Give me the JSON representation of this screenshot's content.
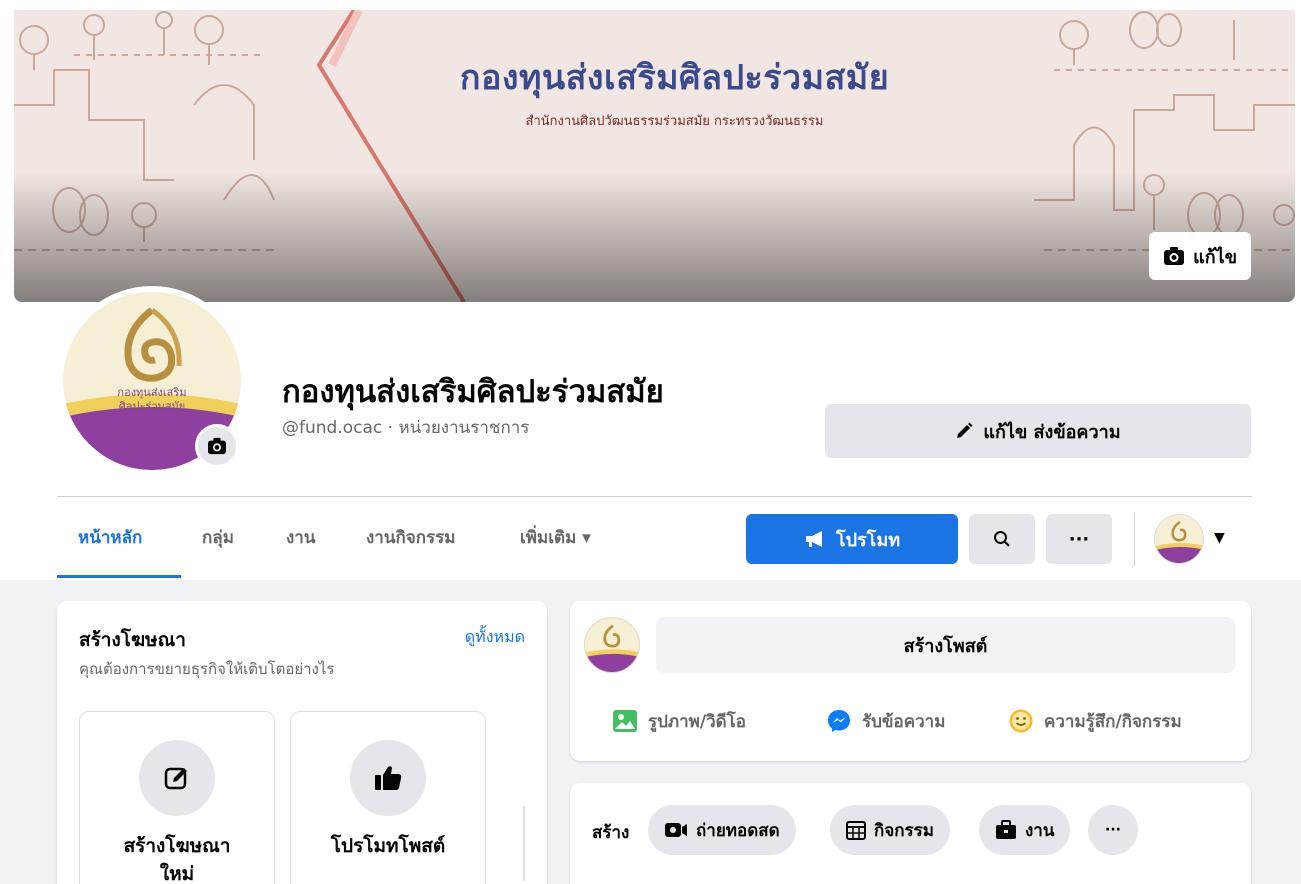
{
  "cover": {
    "title": "กองทุนส่งเสริมศิลปะร่วมสมัย",
    "subtitle": "สำนักงานศิลปวัฒนธรรมร่วมสมัย กระทรวงวัฒนธรรม",
    "edit_label": "แก้ไข"
  },
  "profile": {
    "name": "กองทุนส่งเสริมศิลปะร่วมสมัย",
    "handle": "@fund.ocac · หน่วยงานราชการ",
    "edit_send_label": "แก้ไข ส่งข้อความ"
  },
  "nav": {
    "tabs": [
      {
        "label": "หน้าหลัก",
        "active": true
      },
      {
        "label": "กลุ่ม"
      },
      {
        "label": "งาน"
      },
      {
        "label": "งานกิจกรรม"
      },
      {
        "label": "เพิ่มเติม ▾"
      }
    ],
    "promote_label": "โปรโมท",
    "more_label": "···"
  },
  "ads": {
    "title": "สร้างโฆษณา",
    "see_all": "ดูทั้งหมด",
    "subtitle": "คุณต้องการขยายธุรกิจให้เติบโตอย่างไร",
    "options": [
      {
        "label_line1": "สร้างโฆษณา",
        "label_line2": "ใหม่",
        "icon": "edit-icon"
      },
      {
        "label_line1": "โปรโมทโพสต์",
        "label_line2": "",
        "icon": "thumbs-up-icon"
      }
    ]
  },
  "composer": {
    "create_post_label": "สร้างโพสต์",
    "actions": [
      {
        "label": "รูปภาพ/วิดีโอ",
        "icon": "photo-icon",
        "color": "#45bd62"
      },
      {
        "label": "รับข้อความ",
        "icon": "messenger-icon",
        "color": "#0a7cff"
      },
      {
        "label": "ความรู้สึก/กิจกรรม",
        "icon": "smile-icon",
        "color": "#f7b928"
      }
    ]
  },
  "create_bar": {
    "label": "สร้าง",
    "items": [
      {
        "label": "ถ่ายทอดสด",
        "icon": "live-video-icon"
      },
      {
        "label": "กิจกรรม",
        "icon": "calendar-icon"
      },
      {
        "label": "งาน",
        "icon": "briefcase-icon"
      }
    ],
    "more_label": "···"
  },
  "colors": {
    "brand_blue": "#1b74e4",
    "cover_title": "#3b4a8f",
    "logo_purple": "#8e3fa0",
    "logo_gold": "#c9a24b"
  }
}
